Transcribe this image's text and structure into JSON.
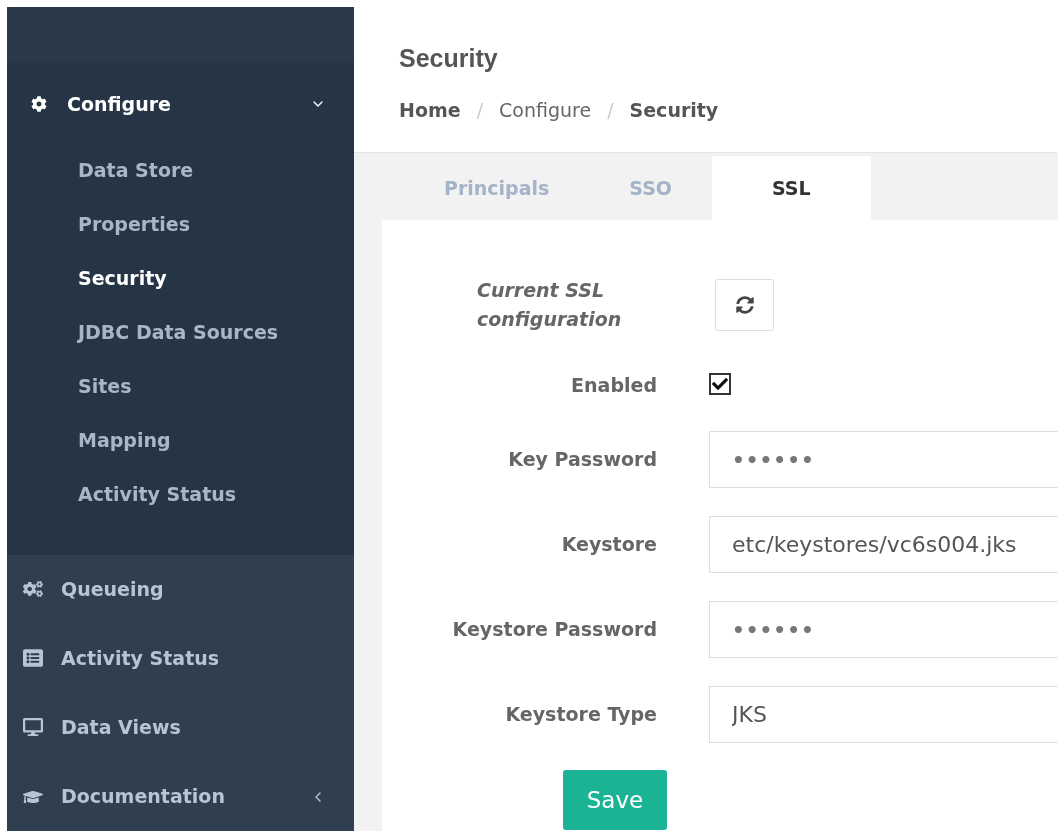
{
  "sidebar": {
    "items": [
      {
        "kind": "group",
        "label": "Configure",
        "expanded": true,
        "children": [
          {
            "label": "Data Store",
            "selected": false
          },
          {
            "label": "Properties",
            "selected": false
          },
          {
            "label": "Security",
            "selected": true
          },
          {
            "label": "JDBC Data Sources",
            "selected": false
          },
          {
            "label": "Sites",
            "selected": false
          },
          {
            "label": "Mapping",
            "selected": false
          },
          {
            "label": "Activity Status",
            "selected": false
          }
        ]
      },
      {
        "kind": "link",
        "label": "Queueing"
      },
      {
        "kind": "link",
        "label": "Activity Status"
      },
      {
        "kind": "link",
        "label": "Data Views"
      },
      {
        "kind": "group",
        "label": "Documentation",
        "expanded": false
      }
    ]
  },
  "header": {
    "title": "Security",
    "breadcrumb": [
      "Home",
      "Configure",
      "Security"
    ],
    "separator": "/"
  },
  "tabs": [
    {
      "label": "Principals",
      "selected": false
    },
    {
      "label": "SSO",
      "selected": false
    },
    {
      "label": "SSL",
      "selected": true
    }
  ],
  "form": {
    "rows": [
      {
        "kind": "refresh",
        "label": "Current SSL configuration"
      },
      {
        "kind": "checkbox",
        "label": "Enabled",
        "checked": true
      },
      {
        "kind": "field",
        "label": "Key Password",
        "value": "••••••",
        "masked": true
      },
      {
        "kind": "field",
        "label": "Keystore",
        "value": "etc/keystores/vc6s004.jks",
        "masked": false
      },
      {
        "kind": "field",
        "label": "Keystore Password",
        "value": "••••••",
        "masked": true
      },
      {
        "kind": "field",
        "label": "Keystore Type",
        "value": "JKS",
        "masked": false
      }
    ],
    "save_button": "Save"
  }
}
